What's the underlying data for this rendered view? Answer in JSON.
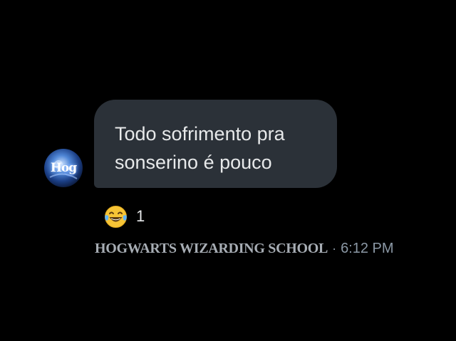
{
  "message": {
    "lines": [
      "Todo sofrimento pra",
      "sonserino é pouco"
    ],
    "avatar": {
      "icon": "hogwarts-logo-avatar",
      "logo_text": "Hog"
    },
    "reaction": {
      "emoji_icon": "face-with-tears-of-joy-icon",
      "count": "1"
    },
    "sender_name": "HOGWARTS WIZARDING SCHOOL",
    "separator": "·",
    "timestamp": "6:12 PM"
  },
  "colors": {
    "background": "#000000",
    "bubble": "#2b3138",
    "message_text": "#e7e9ea",
    "meta_text": "#8b98a5"
  }
}
